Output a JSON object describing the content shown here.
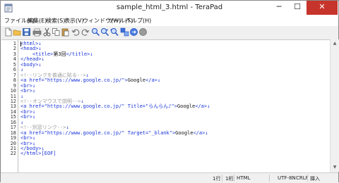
{
  "window": {
    "title": "sample_html_3.html - TeraPad",
    "min": "─",
    "max": "☐",
    "close": "✕"
  },
  "menu": [
    "ファイル(F)",
    "編集(E)",
    "検索(S)",
    "表示(V)",
    "ウィンドウ(W)",
    "ツール(T)",
    "ヘルプ(H)"
  ],
  "toolbar": [
    "new-file",
    "open-file",
    "save-file",
    "print",
    "cut",
    "copy",
    "paste",
    "undo",
    "redo",
    "find",
    "find-next",
    "find-previous",
    "replace",
    "jump",
    "stop"
  ],
  "editor": {
    "line_numbers": [
      "1",
      "2",
      "3",
      "4",
      "5",
      "6",
      "7",
      "8",
      "9",
      "10",
      "11",
      "12",
      "13",
      "14",
      "15",
      "16",
      "17",
      "18",
      "19",
      "20",
      "21",
      "22"
    ],
    "lines": [
      {
        "indent": "",
        "t": [
          [
            "tag",
            "<html>"
          ],
          [
            "tag",
            "↓"
          ]
        ]
      },
      {
        "indent": "",
        "t": [
          [
            "tag",
            "<head>"
          ],
          [
            "tag",
            "↓"
          ]
        ]
      },
      {
        "indent": "    ",
        "t": [
          [
            "tag",
            "<title>"
          ],
          [
            "plain",
            "第3回"
          ],
          [
            "tag",
            "</title>"
          ],
          [
            "tag",
            "↓"
          ]
        ]
      },
      {
        "indent": "",
        "t": [
          [
            "tag",
            "</head>"
          ],
          [
            "tag",
            "↓"
          ]
        ]
      },
      {
        "indent": "",
        "t": [
          [
            "tag",
            "<body>"
          ],
          [
            "tag",
            "↓"
          ]
        ]
      },
      {
        "indent": "",
        "t": [
          [
            "tag",
            "↓"
          ]
        ]
      },
      {
        "indent": "",
        "t": [
          [
            "cmt",
            "<!--リンクを普通に貼る-->"
          ],
          [
            "tag",
            "↓"
          ]
        ]
      },
      {
        "indent": "",
        "t": [
          [
            "tag",
            "<a href="
          ],
          [
            "str",
            "\"https://www.google.co.jp/\""
          ],
          [
            "tag",
            ">"
          ],
          [
            "plain",
            "Google"
          ],
          [
            "tag",
            "</a>"
          ],
          [
            "tag",
            "↓"
          ]
        ]
      },
      {
        "indent": "",
        "t": [
          [
            "tag",
            "<br>"
          ],
          [
            "tag",
            "↓"
          ]
        ]
      },
      {
        "indent": "",
        "t": [
          [
            "tag",
            "<br>"
          ],
          [
            "tag",
            "↓"
          ]
        ]
      },
      {
        "indent": "",
        "t": [
          [
            "tag",
            "↓"
          ]
        ]
      },
      {
        "indent": "",
        "t": [
          [
            "cmt",
            "<!--オンマウスで説明-->"
          ],
          [
            "tag",
            "↓"
          ]
        ]
      },
      {
        "indent": "",
        "t": [
          [
            "tag",
            "<a href="
          ],
          [
            "str",
            "\"https://www.google.co.jp/\""
          ],
          [
            "tag",
            " Title="
          ],
          [
            "str",
            "\"らんらん♪\""
          ],
          [
            "tag",
            ">"
          ],
          [
            "plain",
            "Google"
          ],
          [
            "tag",
            "</a>"
          ],
          [
            "tag",
            "↓"
          ]
        ]
      },
      {
        "indent": "",
        "t": [
          [
            "tag",
            "<br>"
          ],
          [
            "tag",
            "↓"
          ]
        ]
      },
      {
        "indent": "",
        "t": [
          [
            "tag",
            "<br>"
          ],
          [
            "tag",
            "↓"
          ]
        ]
      },
      {
        "indent": "",
        "t": [
          [
            "tag",
            "↓"
          ]
        ]
      },
      {
        "indent": "",
        "t": [
          [
            "cmt",
            "<!--別窓リンク-->"
          ],
          [
            "tag",
            "↓"
          ]
        ]
      },
      {
        "indent": "",
        "t": [
          [
            "tag",
            "<a href="
          ],
          [
            "str",
            "\"https://www.google.co.jp/\""
          ],
          [
            "tag",
            " Target="
          ],
          [
            "str",
            "\"_blank\""
          ],
          [
            "tag",
            ">"
          ],
          [
            "plain",
            "Google"
          ],
          [
            "tag",
            "</a>"
          ],
          [
            "tag",
            "↓"
          ]
        ]
      },
      {
        "indent": "",
        "t": [
          [
            "tag",
            "<br>"
          ],
          [
            "tag",
            "↓"
          ]
        ]
      },
      {
        "indent": "",
        "t": [
          [
            "tag",
            "<br>"
          ],
          [
            "tag",
            "↓"
          ]
        ]
      },
      {
        "indent": "",
        "t": [
          [
            "tag",
            "</body>"
          ],
          [
            "tag",
            "↓"
          ]
        ]
      },
      {
        "indent": "",
        "t": [
          [
            "tag",
            "</html>"
          ],
          [
            "eof",
            "[EOF]"
          ]
        ]
      }
    ]
  },
  "status": {
    "line": "1行",
    "col": "1桁",
    "mode": "HTML",
    "encoding": "UTF-8N",
    "newline": "CRLF",
    "insert": "挿入"
  }
}
